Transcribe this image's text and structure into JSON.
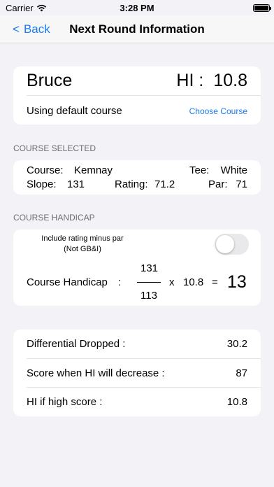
{
  "status_bar": {
    "carrier": "Carrier",
    "time": "3:28 PM"
  },
  "nav": {
    "back_label": "Back",
    "title": "Next Round Information"
  },
  "player": {
    "name": "Bruce",
    "hi_label": "HI :",
    "hi_value": "10.8",
    "course_status": "Using default course",
    "choose_course_label": "Choose Course"
  },
  "course_section": {
    "header": "COURSE SELECTED",
    "course_label": "Course:",
    "course_value": "Kemnay",
    "tee_label": "Tee:",
    "tee_value": "White",
    "slope_label": "Slope:",
    "slope_value": "131",
    "rating_label": "Rating:",
    "rating_value": "71.2",
    "par_label": "Par:",
    "par_value": "71"
  },
  "handicap_section": {
    "header": "COURSE HANDICAP",
    "include_line1": "Include rating minus par",
    "include_line2": "(Not GB&I)",
    "toggle_on": false,
    "label": "Course Handicap",
    "colon": ":",
    "numerator": "131",
    "denominator": "113",
    "times": "x",
    "hi_value": "10.8",
    "equals": "=",
    "result": "13"
  },
  "stats": [
    {
      "label": "Differential Dropped :",
      "value": "30.2"
    },
    {
      "label": "Score when HI will decrease :",
      "value": "87"
    },
    {
      "label": "HI if high score :",
      "value": "10.8"
    }
  ],
  "colors": {
    "accent": "#1a7cf0",
    "background": "#f2f2f7",
    "card": "#ffffff"
  }
}
